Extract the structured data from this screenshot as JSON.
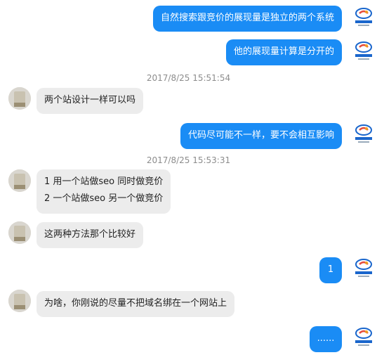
{
  "colors": {
    "outgoing_bubble": "#1a8cf5",
    "incoming_bubble": "#ececec",
    "timestamp": "#8c8c8c"
  },
  "messages": [
    {
      "side": "out",
      "text": "自然搜索跟竞价的展现量是独立的两个系统"
    },
    {
      "side": "out",
      "text": "他的展现量计算是分开的"
    },
    {
      "timestamp": "2017/8/25 15:51:54"
    },
    {
      "side": "in",
      "text": "两个站设计一样可以吗"
    },
    {
      "side": "out",
      "text": "代码尽可能不一样，要不会相互影响"
    },
    {
      "timestamp": "2017/8/25 15:53:31"
    },
    {
      "side": "in",
      "lines": [
        "1  用一个站做seo 同时做竞价",
        "2 一个站做seo 另一个做竞价"
      ]
    },
    {
      "side": "in",
      "text": "这两种方法那个比较好"
    },
    {
      "side": "out",
      "text": "1"
    },
    {
      "side": "in",
      "text": "为啥，你刚说的尽量不把域名绑在一个网站上"
    },
    {
      "side": "out",
      "text": "......"
    }
  ]
}
